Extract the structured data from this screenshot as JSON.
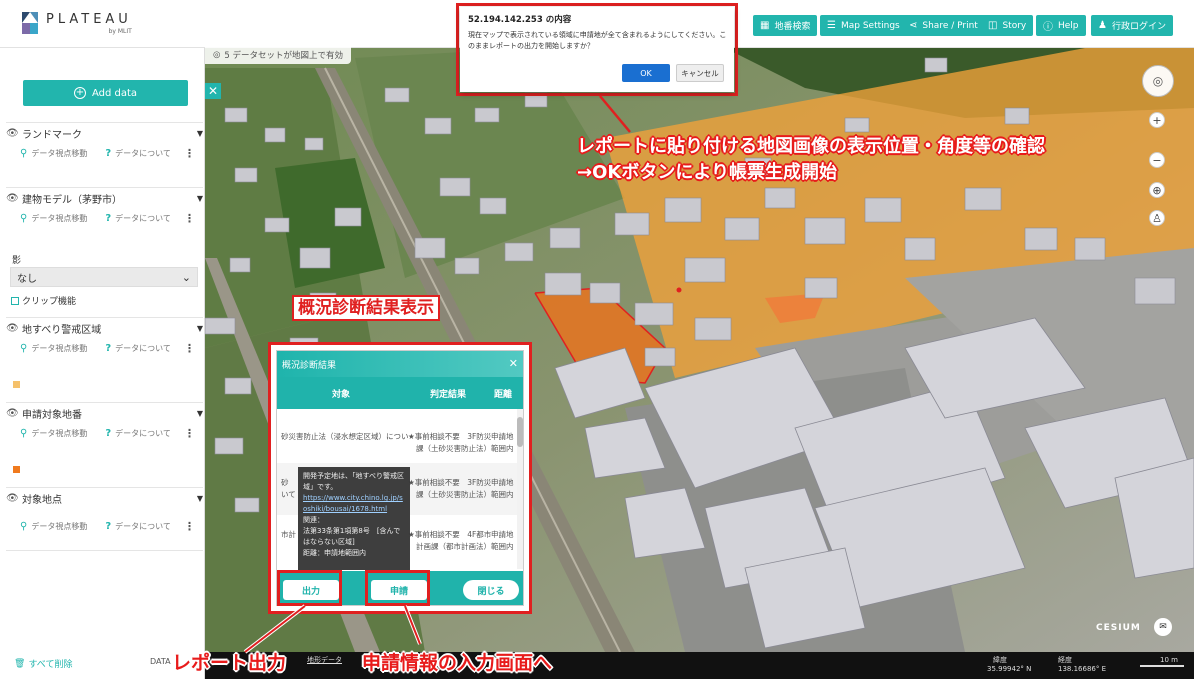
{
  "header": {
    "logo_text": "PLATEAU",
    "logo_sub": "by MLIT",
    "buttons": [
      {
        "id": "chiban",
        "label": "地番検索",
        "icon": "building-icon"
      },
      {
        "id": "map_settings",
        "label": "Map Settings",
        "icon": "sliders-icon"
      },
      {
        "id": "share",
        "label": "Share / Print",
        "icon": "share-icon"
      },
      {
        "id": "story",
        "label": "Story",
        "icon": "story-icon"
      },
      {
        "id": "help",
        "label": "Help",
        "icon": "help-icon"
      },
      {
        "id": "login",
        "label": "行政ログイン",
        "icon": "user-icon"
      }
    ]
  },
  "status": {
    "text": "5 データセットが地図上で有効"
  },
  "sidebar": {
    "add_data": "Add data",
    "close": "✕",
    "layers": [
      {
        "name": "ランドマーク",
        "move": "データ視点移動",
        "about": "データについて"
      },
      {
        "name": "建物モデル（茅野市）",
        "move": "データ視点移動",
        "about": "データについて"
      },
      {
        "name": "地すべり警戒区域",
        "move": "データ視点移動",
        "about": "データについて"
      },
      {
        "name": "申請対象地番",
        "move": "データ視点移動",
        "about": "データについて"
      },
      {
        "name": "対象地点",
        "move": "データ視点移動",
        "about": "データについて"
      }
    ],
    "shadow_label": "影",
    "shadow_value": "なし",
    "clip_label": "クリップ機能",
    "clear_all": "すべて削除",
    "data_label": "DATA"
  },
  "confirm": {
    "title": "52.194.142.253 の内容",
    "message": "現在マップで表示されている領域に申請地が全て含まれるようにしてください。このままレポートの出力を開始しますか？",
    "ok": "OK",
    "cancel": "キャンセル"
  },
  "diagnosis": {
    "title": "概況診断結果",
    "close": "✕",
    "columns": [
      "対象",
      "判定結果",
      "距離"
    ],
    "rows": [
      {
        "target": "砂災害防止法（浸水想定区域）につい",
        "result": "★事前相談不要　3F防災",
        "result2": "課（土砂災害防止法）",
        "distance": "申請地",
        "distance2": "範囲内"
      },
      {
        "target": "砂",
        "target2": "いて",
        "result": "★事前相談不要　3F防災",
        "result2": "課（土砂災害防止法）",
        "distance": "申請地",
        "distance2": "範囲内"
      },
      {
        "target": "市計",
        "result": "★事前相談不要　4F都市",
        "result2": "計画課（都市計画法）",
        "distance": "申請地",
        "distance2": "範囲内"
      }
    ],
    "tooltip_lines": [
      "開発予定地は、「地すべり警戒区",
      "域」です。"
    ],
    "tooltip_link": [
      "https://www.city.chino.lg.jp/s",
      "oshiki/bousai/1678.html"
    ],
    "tooltip_more": [
      "関連：",
      "法第33条第1項第8号　[含んで",
      "はならない区域]",
      "距離：申請地範囲内"
    ],
    "buttons": {
      "output": "出力",
      "apply": "申請",
      "close": "閉じる"
    }
  },
  "annotations": {
    "confirm_line1": "レポートに貼り付ける地図画像の表示位置・角度等の確認",
    "confirm_line2": "→OKボタンにより帳票生成開始",
    "diag_title": "概況診断結果表示",
    "report_output": "レポート出力",
    "apply_input": "申請情報の入力画面へ"
  },
  "map": {
    "cesium": "CESIUM",
    "bottom_left": "地形データ",
    "lat_label": "緯度",
    "lat_value": "35.99942° N",
    "lon_label": "経度",
    "lon_value": "138.16686° E",
    "scale": "10 m"
  },
  "colors": {
    "accent": "#22b5ad",
    "annotation_red": "#e02020",
    "hazard_orange": "#f2a23a"
  }
}
